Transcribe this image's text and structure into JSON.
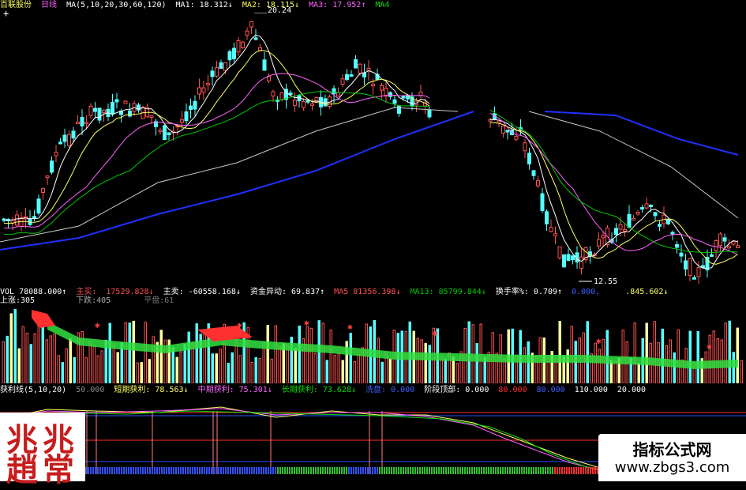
{
  "header": {
    "stock_name": "百联股份",
    "period": "日线",
    "ma_params": "MA(5,10,20,30,60,120)",
    "ma1": "MA1: 18.312↓",
    "ma2": "MA2: 18.115↓",
    "ma3": "MA3: 17.952↑",
    "ma4": "MA4",
    "plus": "+"
  },
  "price_annotations": {
    "high": "20.24",
    "low": "12.55"
  },
  "vol_header": {
    "vol": "VOL 78088.000↑",
    "main_buy_label": "主买:",
    "main_buy_val": "17529.828↓",
    "main_sell": "主卖: -60558.168↓",
    "fund_move": "资金异动: 69.837↑",
    "ma5": "MA5 81356.398↓",
    "ma13": "MA13: 85799.844↓",
    "turnover": "换手率%: 0.709↑",
    "extra1": "0.000,",
    "extra2": ".845.602↓",
    "rise": "上涨:305",
    "fall": "下跌:405",
    "flat": "平盘:61"
  },
  "profit_header": {
    "name": "获利线(5,10,20)",
    "p1": "50.000",
    "short": "短期获利: 78.563↓",
    "mid": "中期获利: 75.301↓",
    "long": "长期获利: 73.628↓",
    "wash": "洗盘: 0.000",
    "top": "阶段顶部: 0.000",
    "v80a": "80.000",
    "v80b": "80.000",
    "v110": "110.000",
    "v20": "20.000"
  },
  "watermark": {
    "seal_chars": [
      "兆",
      "兆",
      "趙",
      "常"
    ],
    "title": "指标公式网",
    "url": "www.zbgs3.com"
  },
  "colors": {
    "up": "#ff5050",
    "down": "#54ffff",
    "ma1": "#ffffff",
    "ma2": "#ffff60",
    "ma3": "#ff60ff",
    "ma4": "#00c800",
    "ma5": "#c8c8c8",
    "ma6": "#2030ff"
  }
}
